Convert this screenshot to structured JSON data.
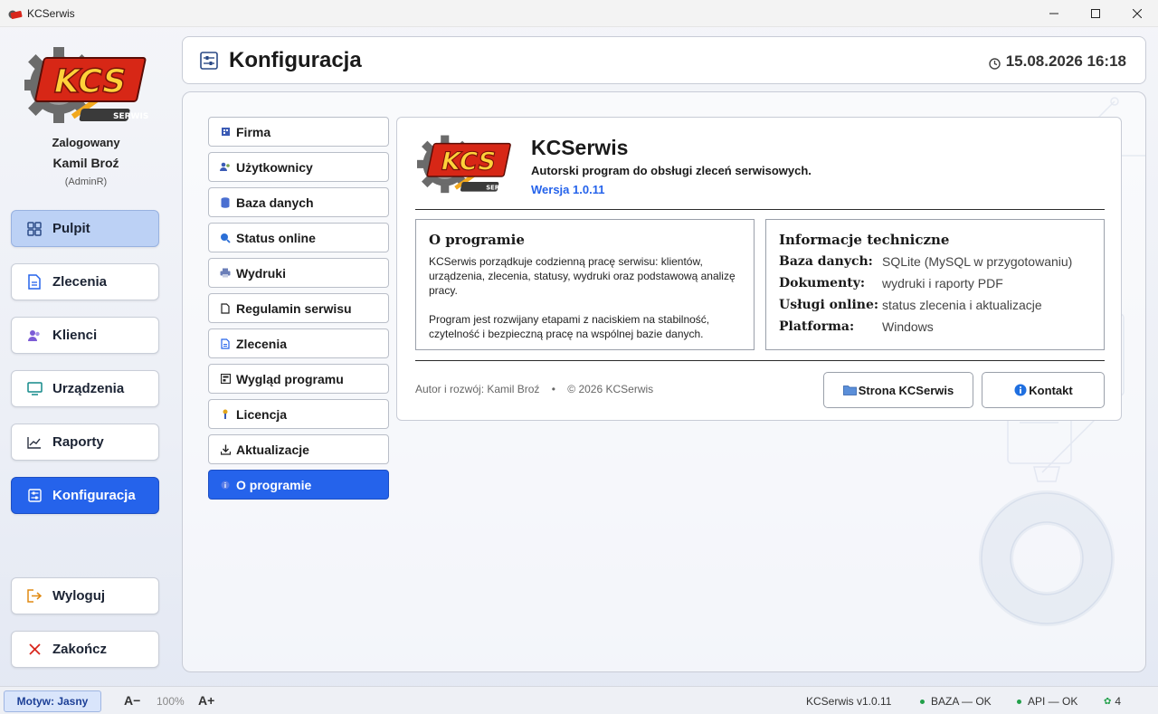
{
  "window": {
    "title": "KCSerwis"
  },
  "sidebar": {
    "logo_text": "KCS",
    "logo_subtext": "SERWIS",
    "logged_label": "Zalogowany",
    "user_name": "Kamil Broź",
    "user_role": "(AdminR)",
    "nav": [
      {
        "label": "Pulpit",
        "icon": "dashboard-icon"
      },
      {
        "label": "Zlecenia",
        "icon": "document-icon"
      },
      {
        "label": "Klienci",
        "icon": "users-icon"
      },
      {
        "label": "Urządzenia",
        "icon": "monitor-icon"
      },
      {
        "label": "Raporty",
        "icon": "chart-icon"
      },
      {
        "label": "Konfiguracja",
        "icon": "settings-icon"
      }
    ],
    "bottom": [
      {
        "label": "Wyloguj",
        "icon": "logout-icon"
      },
      {
        "label": "Zakończ",
        "icon": "close-icon"
      }
    ]
  },
  "header": {
    "title": "Konfiguracja",
    "datetime": "15.08.2026 16:18"
  },
  "config_menu": {
    "items": [
      {
        "label": "Firma",
        "icon": "company-icon"
      },
      {
        "label": "Użytkownicy",
        "icon": "users-icon"
      },
      {
        "label": "Baza danych",
        "icon": "database-icon"
      },
      {
        "label": "Status online",
        "icon": "search-globe-icon"
      },
      {
        "label": "Wydruki",
        "icon": "printer-icon"
      },
      {
        "label": "Regulamin serwisu",
        "icon": "page-icon"
      },
      {
        "label": "Zlecenia",
        "icon": "document-icon"
      },
      {
        "label": "Wygląd programu",
        "icon": "layout-icon"
      },
      {
        "label": "Licencja",
        "icon": "key-icon"
      },
      {
        "label": "Aktualizacje",
        "icon": "download-icon"
      },
      {
        "label": "O programie",
        "icon": "info-icon"
      }
    ],
    "active_index": 10
  },
  "about": {
    "app_name": "KCSerwis",
    "subtitle": "Autorski program do obsługi zleceń serwisowych.",
    "version": "Wersja 1.0.11",
    "program_box": {
      "title": "O programie",
      "paragraph1": "KCSerwis porządkuje codzienną pracę serwisu: klientów, urządzenia, zlecenia, statusy, wydruki oraz podstawową analizę pracy.",
      "paragraph2": "Program jest rozwijany etapami z naciskiem na stabilność, czytelność i bezpieczną pracę na wspólnej bazie danych."
    },
    "tech_box": {
      "title": "Informacje techniczne",
      "rows": [
        {
          "key": "Baza danych:",
          "value": "SQLite (MySQL w przygotowaniu)"
        },
        {
          "key": "Dokumenty:",
          "value": "wydruki i raporty PDF"
        },
        {
          "key": "Usługi online:",
          "value": "status zlecenia i aktualizacje"
        },
        {
          "key": "Platforma:",
          "value": "Windows"
        }
      ]
    },
    "footer_author": "Autor i rozwój: Kamil Broź",
    "footer_sep": "•",
    "footer_copyright": "© 2026 KCSerwis",
    "btn_website": "Strona KCSerwis",
    "btn_contact": "Kontakt"
  },
  "statusbar": {
    "theme": "Motyw: Jasny",
    "zoom_minus": "A−",
    "zoom": "100%",
    "zoom_plus": "A+",
    "version": "KCSerwis v1.0.11",
    "db_status": "BAZA — OK",
    "api_status": "API — OK",
    "count": "4"
  },
  "colors": {
    "accent": "#2563eb",
    "pulpit_bg": "#bcd1f5",
    "status_ok": "#22a04a"
  }
}
